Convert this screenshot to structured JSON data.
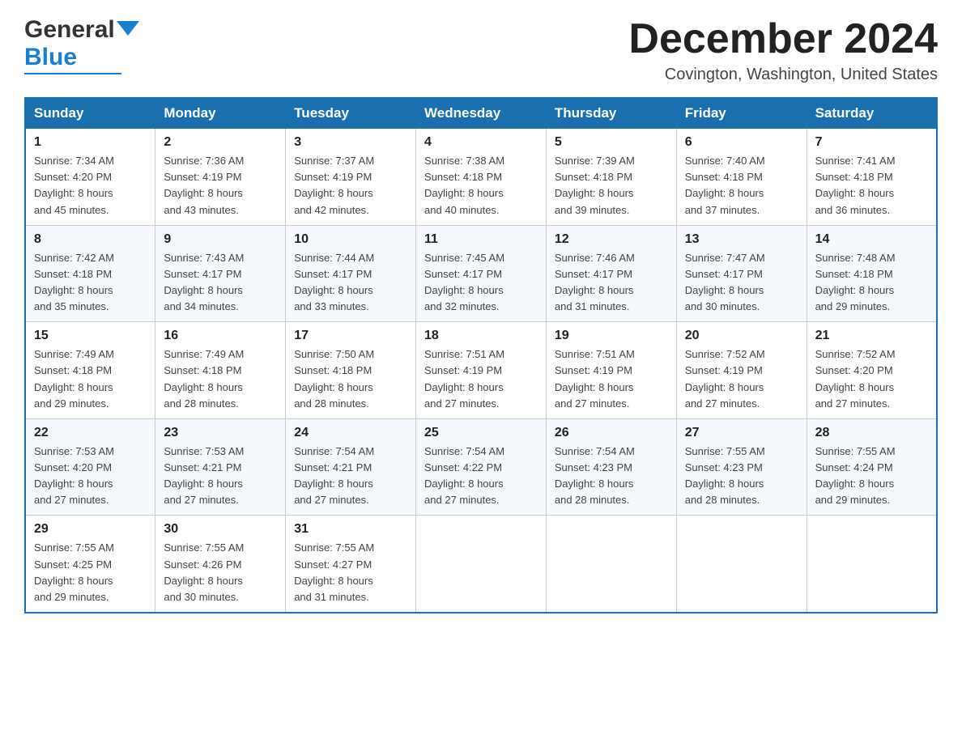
{
  "header": {
    "logo_general": "General",
    "logo_blue": "Blue",
    "month_title": "December 2024",
    "location": "Covington, Washington, United States"
  },
  "days_of_week": [
    "Sunday",
    "Monday",
    "Tuesday",
    "Wednesday",
    "Thursday",
    "Friday",
    "Saturday"
  ],
  "weeks": [
    [
      {
        "day": "1",
        "sunrise": "7:34 AM",
        "sunset": "4:20 PM",
        "daylight": "8 hours and 45 minutes."
      },
      {
        "day": "2",
        "sunrise": "7:36 AM",
        "sunset": "4:19 PM",
        "daylight": "8 hours and 43 minutes."
      },
      {
        "day": "3",
        "sunrise": "7:37 AM",
        "sunset": "4:19 PM",
        "daylight": "8 hours and 42 minutes."
      },
      {
        "day": "4",
        "sunrise": "7:38 AM",
        "sunset": "4:18 PM",
        "daylight": "8 hours and 40 minutes."
      },
      {
        "day": "5",
        "sunrise": "7:39 AM",
        "sunset": "4:18 PM",
        "daylight": "8 hours and 39 minutes."
      },
      {
        "day": "6",
        "sunrise": "7:40 AM",
        "sunset": "4:18 PM",
        "daylight": "8 hours and 37 minutes."
      },
      {
        "day": "7",
        "sunrise": "7:41 AM",
        "sunset": "4:18 PM",
        "daylight": "8 hours and 36 minutes."
      }
    ],
    [
      {
        "day": "8",
        "sunrise": "7:42 AM",
        "sunset": "4:18 PM",
        "daylight": "8 hours and 35 minutes."
      },
      {
        "day": "9",
        "sunrise": "7:43 AM",
        "sunset": "4:17 PM",
        "daylight": "8 hours and 34 minutes."
      },
      {
        "day": "10",
        "sunrise": "7:44 AM",
        "sunset": "4:17 PM",
        "daylight": "8 hours and 33 minutes."
      },
      {
        "day": "11",
        "sunrise": "7:45 AM",
        "sunset": "4:17 PM",
        "daylight": "8 hours and 32 minutes."
      },
      {
        "day": "12",
        "sunrise": "7:46 AM",
        "sunset": "4:17 PM",
        "daylight": "8 hours and 31 minutes."
      },
      {
        "day": "13",
        "sunrise": "7:47 AM",
        "sunset": "4:17 PM",
        "daylight": "8 hours and 30 minutes."
      },
      {
        "day": "14",
        "sunrise": "7:48 AM",
        "sunset": "4:18 PM",
        "daylight": "8 hours and 29 minutes."
      }
    ],
    [
      {
        "day": "15",
        "sunrise": "7:49 AM",
        "sunset": "4:18 PM",
        "daylight": "8 hours and 29 minutes."
      },
      {
        "day": "16",
        "sunrise": "7:49 AM",
        "sunset": "4:18 PM",
        "daylight": "8 hours and 28 minutes."
      },
      {
        "day": "17",
        "sunrise": "7:50 AM",
        "sunset": "4:18 PM",
        "daylight": "8 hours and 28 minutes."
      },
      {
        "day": "18",
        "sunrise": "7:51 AM",
        "sunset": "4:19 PM",
        "daylight": "8 hours and 27 minutes."
      },
      {
        "day": "19",
        "sunrise": "7:51 AM",
        "sunset": "4:19 PM",
        "daylight": "8 hours and 27 minutes."
      },
      {
        "day": "20",
        "sunrise": "7:52 AM",
        "sunset": "4:19 PM",
        "daylight": "8 hours and 27 minutes."
      },
      {
        "day": "21",
        "sunrise": "7:52 AM",
        "sunset": "4:20 PM",
        "daylight": "8 hours and 27 minutes."
      }
    ],
    [
      {
        "day": "22",
        "sunrise": "7:53 AM",
        "sunset": "4:20 PM",
        "daylight": "8 hours and 27 minutes."
      },
      {
        "day": "23",
        "sunrise": "7:53 AM",
        "sunset": "4:21 PM",
        "daylight": "8 hours and 27 minutes."
      },
      {
        "day": "24",
        "sunrise": "7:54 AM",
        "sunset": "4:21 PM",
        "daylight": "8 hours and 27 minutes."
      },
      {
        "day": "25",
        "sunrise": "7:54 AM",
        "sunset": "4:22 PM",
        "daylight": "8 hours and 27 minutes."
      },
      {
        "day": "26",
        "sunrise": "7:54 AM",
        "sunset": "4:23 PM",
        "daylight": "8 hours and 28 minutes."
      },
      {
        "day": "27",
        "sunrise": "7:55 AM",
        "sunset": "4:23 PM",
        "daylight": "8 hours and 28 minutes."
      },
      {
        "day": "28",
        "sunrise": "7:55 AM",
        "sunset": "4:24 PM",
        "daylight": "8 hours and 29 minutes."
      }
    ],
    [
      {
        "day": "29",
        "sunrise": "7:55 AM",
        "sunset": "4:25 PM",
        "daylight": "8 hours and 29 minutes."
      },
      {
        "day": "30",
        "sunrise": "7:55 AM",
        "sunset": "4:26 PM",
        "daylight": "8 hours and 30 minutes."
      },
      {
        "day": "31",
        "sunrise": "7:55 AM",
        "sunset": "4:27 PM",
        "daylight": "8 hours and 31 minutes."
      },
      null,
      null,
      null,
      null
    ]
  ],
  "labels": {
    "sunrise": "Sunrise:",
    "sunset": "Sunset:",
    "daylight": "Daylight:"
  }
}
